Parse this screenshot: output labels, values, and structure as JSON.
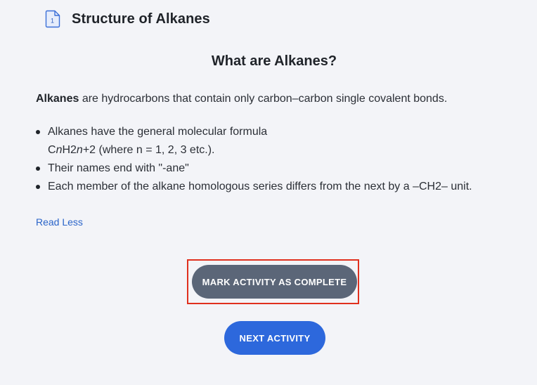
{
  "header": {
    "icon": "document-icon",
    "icon_number": "1",
    "title": "Structure of Alkanes"
  },
  "content": {
    "heading": "What are Alkanes?",
    "intro_bold": "Alkanes",
    "intro_text": " are hydrocarbons that contain only carbon–carbon single covalent bonds.",
    "bullets": [
      {
        "line1": "Alkanes have the general molecular formula",
        "formula_c": "C",
        "formula_n1": "n",
        "formula_h": "H2",
        "formula_n2": "n",
        "formula_rest": "+2 (where n = 1, 2, 3 etc.)."
      },
      {
        "text": "Their names end with \"-ane\""
      },
      {
        "text": "Each member of the alkane homologous series differs from the next by a –CH2– unit."
      }
    ],
    "read_less": "Read Less"
  },
  "actions": {
    "complete_label": "MARK ACTIVITY AS COMPLETE",
    "next_label": "NEXT ACTIVITY"
  },
  "colors": {
    "background": "#f3f4f8",
    "complete_button": "#5b6678",
    "next_button": "#2d68dc",
    "link": "#2a64c9",
    "highlight": "#e0301e"
  }
}
